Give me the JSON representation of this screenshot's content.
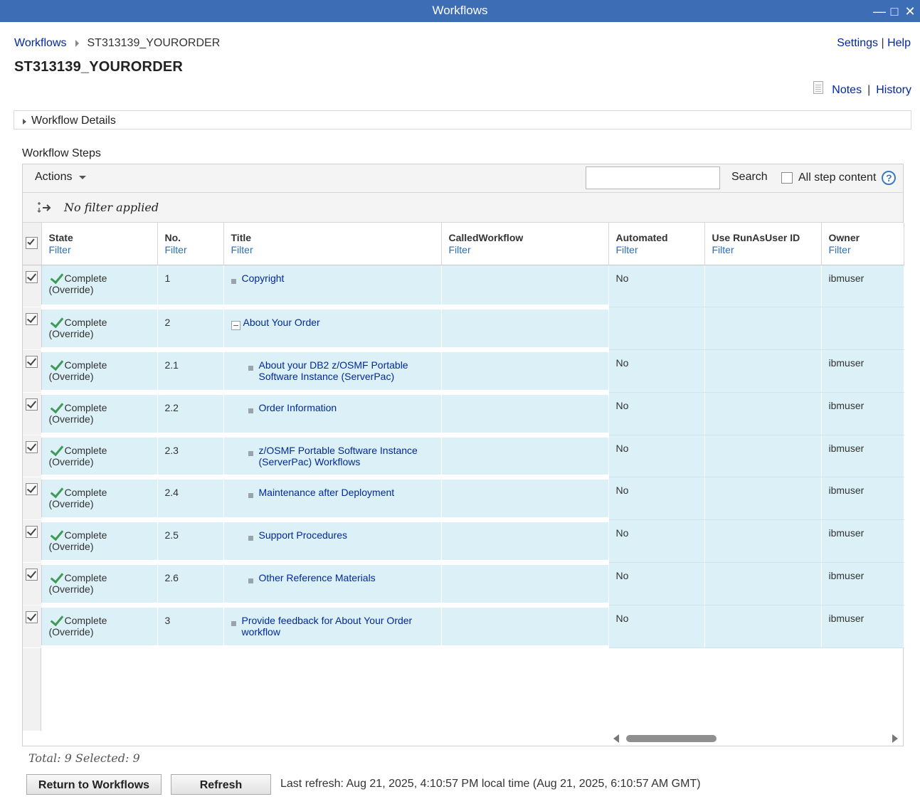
{
  "window": {
    "title": "Workflows",
    "controls": [
      "minimize-icon",
      "maximize-icon",
      "close-icon"
    ]
  },
  "breadcrumb": {
    "root": "Workflows",
    "current": "ST313139_YOURORDER"
  },
  "toplinks": {
    "settings": "Settings",
    "separator": "|",
    "help": "Help"
  },
  "page_title": "ST313139_YOURORDER",
  "notes_bar": {
    "notes": "Notes",
    "separator": "|",
    "history": "History"
  },
  "details": {
    "label": "Workflow Details"
  },
  "steps": {
    "label": "Workflow Steps",
    "toolbar": {
      "actions": "Actions",
      "search_value": "",
      "search_button": "Search",
      "all_step_content": "All step content",
      "help_glyph": "?"
    },
    "filter_status": "No filter applied",
    "columns": [
      {
        "label": "State",
        "filter": "Filter"
      },
      {
        "label": "No.",
        "filter": "Filter"
      },
      {
        "label": "Title",
        "filter": "Filter"
      },
      {
        "label": "CalledWorkflow",
        "filter": "Filter"
      },
      {
        "label": "Automated",
        "filter": "Filter"
      },
      {
        "label": "Use RunAsUser ID",
        "filter": "Filter"
      },
      {
        "label": "Owner",
        "filter": "Filter"
      }
    ],
    "rows": [
      {
        "state": "Complete",
        "state_note": "(Override)",
        "no": "1",
        "title": "Copyright",
        "called": "",
        "automated": "No",
        "runas": "",
        "owner": "ibmuser",
        "level": 0,
        "group": false
      },
      {
        "state": "Complete",
        "state_note": "(Override)",
        "no": "2",
        "title": "About Your Order",
        "called": "",
        "automated": "",
        "runas": "",
        "owner": "",
        "level": 0,
        "group": true
      },
      {
        "state": "Complete",
        "state_note": "(Override)",
        "no": "2.1",
        "title": "About your DB2 z/OSMF Portable Software Instance (ServerPac)",
        "called": "",
        "automated": "No",
        "runas": "",
        "owner": "ibmuser",
        "level": 1,
        "group": false
      },
      {
        "state": "Complete",
        "state_note": "(Override)",
        "no": "2.2",
        "title": "Order Information",
        "called": "",
        "automated": "No",
        "runas": "",
        "owner": "ibmuser",
        "level": 1,
        "group": false
      },
      {
        "state": "Complete",
        "state_note": "(Override)",
        "no": "2.3",
        "title": "z/OSMF Portable Software Instance (ServerPac) Workflows",
        "called": "",
        "automated": "No",
        "runas": "",
        "owner": "ibmuser",
        "level": 1,
        "group": false
      },
      {
        "state": "Complete",
        "state_note": "(Override)",
        "no": "2.4",
        "title": "Maintenance after Deployment",
        "called": "",
        "automated": "No",
        "runas": "",
        "owner": "ibmuser",
        "level": 1,
        "group": false
      },
      {
        "state": "Complete",
        "state_note": "(Override)",
        "no": "2.5",
        "title": "Support Procedures",
        "called": "",
        "automated": "No",
        "runas": "",
        "owner": "ibmuser",
        "level": 1,
        "group": false
      },
      {
        "state": "Complete",
        "state_note": "(Override)",
        "no": "2.6",
        "title": "Other Reference Materials",
        "called": "",
        "automated": "No",
        "runas": "",
        "owner": "ibmuser",
        "level": 1,
        "group": false
      },
      {
        "state": "Complete",
        "state_note": "(Override)",
        "no": "3",
        "title": "Provide feedback for About Your Order workflow",
        "called": "",
        "automated": "No",
        "runas": "",
        "owner": "ibmuser",
        "level": 0,
        "group": false
      }
    ],
    "totals": "Total: 9 Selected: 9"
  },
  "footer": {
    "return_button": "Return to Workflows",
    "refresh_button": "Refresh",
    "last_refresh": "Last refresh: Aug 21, 2025, 4:10:57 PM local time (Aug 21, 2025, 6:10:57 AM GMT)"
  },
  "colors": {
    "titlebar": "#3d6db4",
    "link": "#00299c",
    "filter_link": "#2a6ebd",
    "row_bg": "#dcf0f7",
    "complete_check": "#3f9a57"
  }
}
